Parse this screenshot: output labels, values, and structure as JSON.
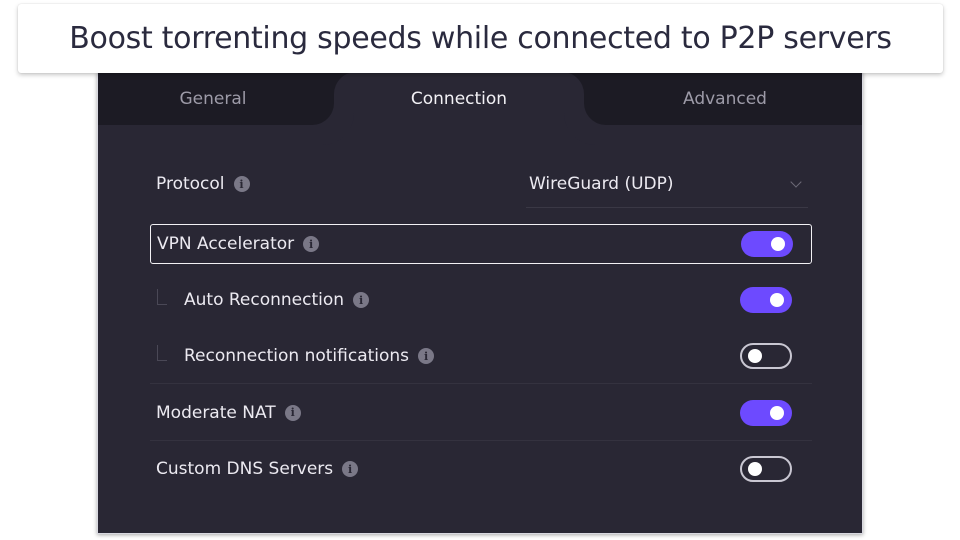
{
  "caption": "Boost torrenting speeds while connected to P2P servers",
  "tabs": [
    {
      "label": "General",
      "active": false
    },
    {
      "label": "Connection",
      "active": true
    },
    {
      "label": "Advanced",
      "active": false
    }
  ],
  "settings": {
    "protocol": {
      "label": "Protocol",
      "value": "WireGuard (UDP)",
      "icon": "info-icon",
      "control_icon": "chevron-down-icon"
    },
    "vpn_accelerator": {
      "label": "VPN Accelerator",
      "enabled": true,
      "icon": "info-icon"
    },
    "auto_reconnection": {
      "label": "Auto Reconnection",
      "enabled": true,
      "icon": "info-icon"
    },
    "reconnection_notifications": {
      "label": "Reconnection notifications",
      "enabled": false,
      "icon": "info-icon"
    },
    "moderate_nat": {
      "label": "Moderate NAT",
      "enabled": true,
      "icon": "info-icon"
    },
    "custom_dns": {
      "label": "Custom DNS Servers",
      "enabled": false,
      "icon": "info-icon"
    }
  },
  "info_glyph": "i",
  "colors": {
    "accent": "#6d4aff",
    "background": "#292734",
    "tabbar": "#1c1b24",
    "text": "#eceaf1",
    "muted": "#9d9ba8"
  }
}
